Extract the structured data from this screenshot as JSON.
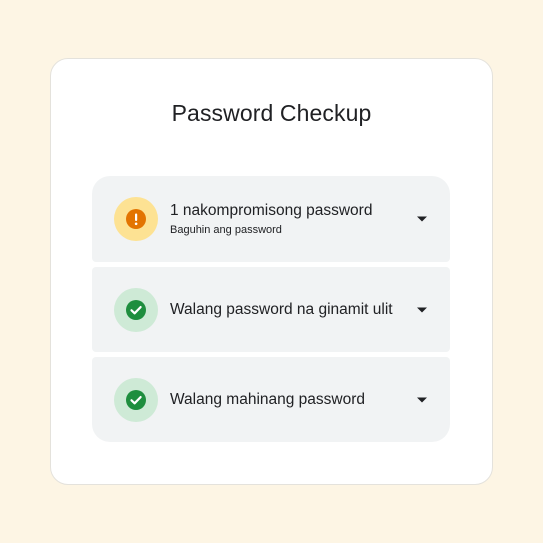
{
  "title": "Password Checkup",
  "items": [
    {
      "label": "1 nakompromisong password",
      "sublabel": "Baguhin ang password",
      "status": "warning",
      "icon": "exclamation-icon",
      "accent_color": "#e37400",
      "badge_color": "#fde293"
    },
    {
      "label": "Walang password na ginamit ulit",
      "status": "ok",
      "icon": "check-icon",
      "accent_color": "#1e8e3e",
      "badge_color": "#ceead6"
    },
    {
      "label": "Walang mahinang password",
      "status": "ok",
      "icon": "check-icon",
      "accent_color": "#1e8e3e",
      "badge_color": "#ceead6"
    }
  ]
}
